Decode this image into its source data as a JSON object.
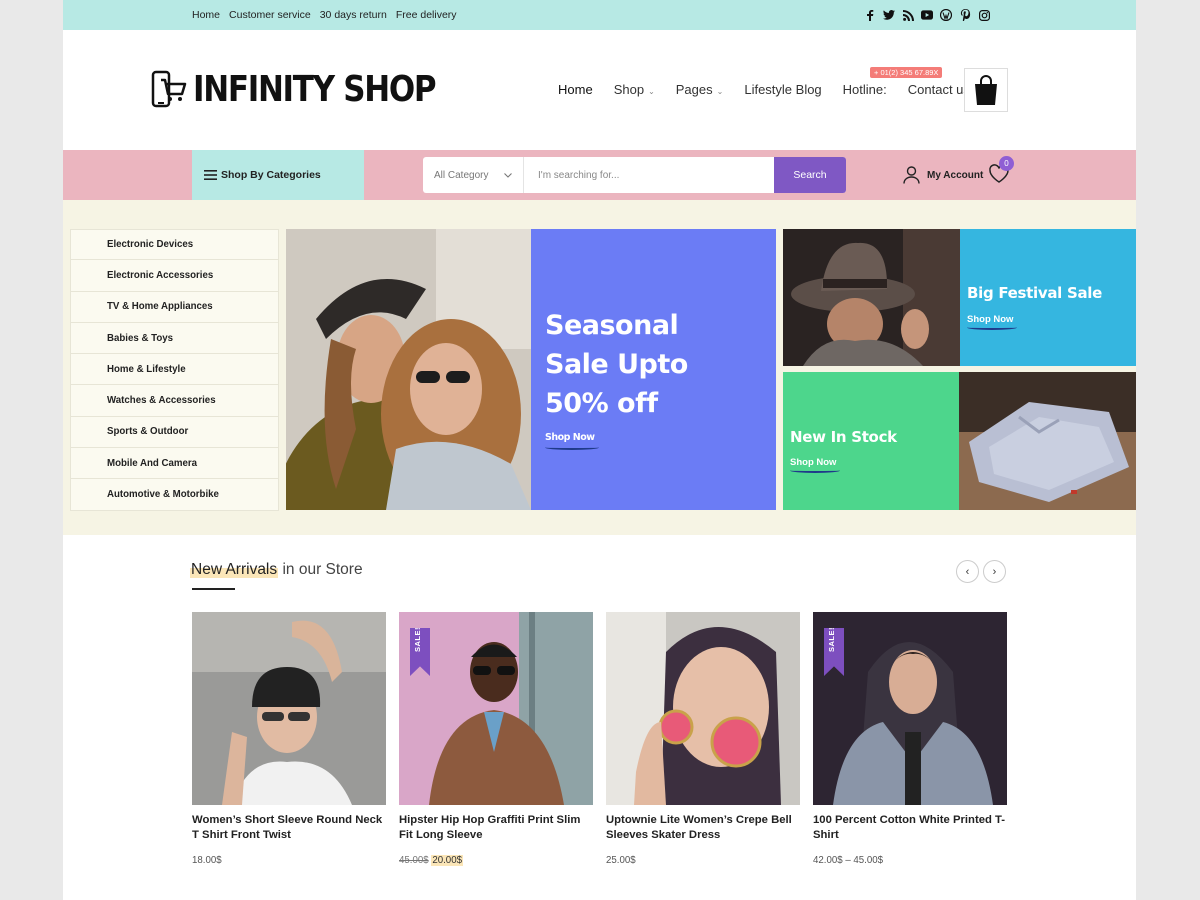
{
  "topbar": {
    "links": [
      "Home",
      "Customer service",
      "30 days return",
      "Free delivery"
    ],
    "social_icons": [
      "facebook-icon",
      "twitter-icon",
      "rss-icon",
      "youtube-icon",
      "wordpress-icon",
      "pinterest-icon",
      "instagram-icon"
    ],
    "background": "#b7e9e4"
  },
  "header": {
    "logo_text": "INFINITY SHOP",
    "nav": [
      {
        "label": "Home",
        "has_caret": false
      },
      {
        "label": "Shop",
        "has_caret": true
      },
      {
        "label": "Pages",
        "has_caret": true
      },
      {
        "label": "Lifestyle Blog",
        "has_caret": false
      },
      {
        "label": "Hotline:",
        "has_caret": false
      },
      {
        "label": "Contact us",
        "has_caret": false
      }
    ],
    "hotline_number": "+ 01(2) 345 67.89X",
    "cart_icon": "shopping-bag-icon"
  },
  "searchbar": {
    "categories_button": "Shop By Categories",
    "category_select": "All Category",
    "placeholder": "I'm searching for...",
    "search_button": "Search",
    "account_label": "My Account",
    "wishlist_count": "0",
    "background": "#ebb5bf",
    "accent": "#7f58c4"
  },
  "categories": [
    "Electronic Devices",
    "Electronic Accessories",
    "TV & Home Appliances",
    "Babies & Toys",
    "Home & Lifestyle",
    "Watches & Accessories",
    "Sports & Outdoor",
    "Mobile And Camera",
    "Automotive & Motorbike"
  ],
  "banners": {
    "main": {
      "line1": "Seasonal",
      "line2": "Sale Upto",
      "line3": "50% off",
      "cta": "Shop Now",
      "color": "#6b7cf5"
    },
    "festival": {
      "title": "Big Festival Sale",
      "cta": "Shop Now",
      "color": "#35b6e0"
    },
    "stock": {
      "title": "New In Stock",
      "cta": "Shop Now",
      "color": "#4dd68c"
    }
  },
  "arrivals": {
    "title_highlight": "New Arrivals",
    "title_rest": "in our Store",
    "sale_badge": "SALE!",
    "products": [
      {
        "name": "Women’s Short Sleeve Round Neck T Shirt Front Twist",
        "price": "18.00$",
        "old_price": "",
        "sale": false
      },
      {
        "name": "Hipster Hip Hop Graffiti Print Slim Fit Long Sleeve",
        "price": "20.00$",
        "old_price": "45.00$",
        "sale": true
      },
      {
        "name": "Uptownie Lite Women’s Crepe Bell Sleeves Skater Dress",
        "price": "25.00$",
        "old_price": "",
        "sale": false
      },
      {
        "name": "100 Percent Cotton White Printed T-Shirt",
        "price": "42.00$ – 45.00$",
        "old_price": "",
        "sale": true
      }
    ]
  }
}
